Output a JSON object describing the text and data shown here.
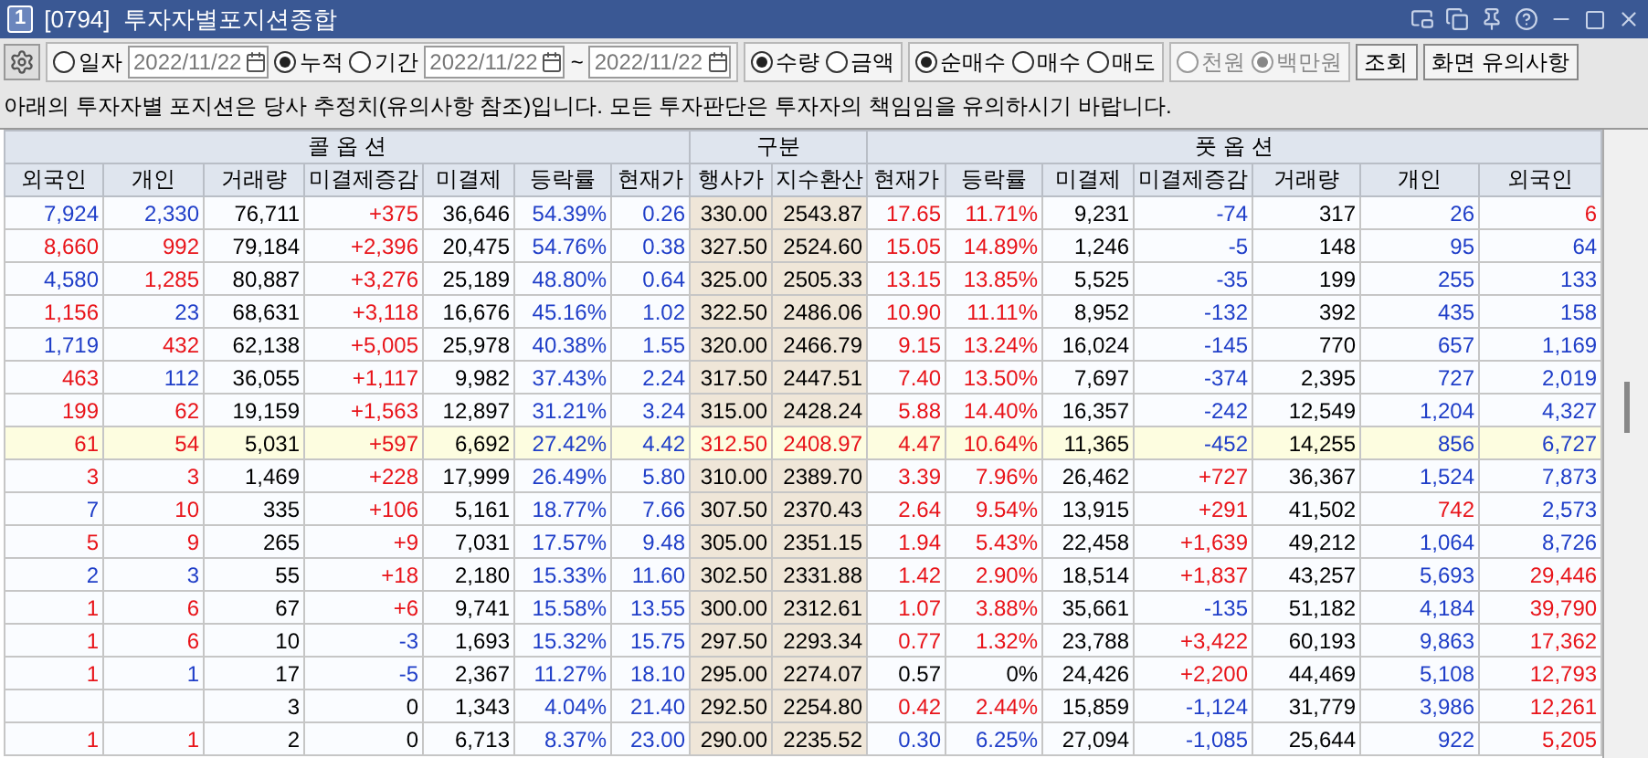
{
  "window": {
    "badge": "1",
    "title": "[0794]  투자자별포지션종합"
  },
  "toolbar": [
    {
      "kind": "radio",
      "label": "일자",
      "selected": false
    },
    {
      "kind": "date",
      "value": "2022/11/22"
    },
    {
      "kind": "radio",
      "label": "누적",
      "selected": true
    },
    {
      "kind": "radio",
      "label": "기간",
      "selected": false
    },
    {
      "kind": "date",
      "value": "2022/11/22"
    },
    {
      "kind": "text",
      "text": "~"
    },
    {
      "kind": "date",
      "value": "2022/11/22"
    }
  ],
  "radio_groups": [
    {
      "disabled": false,
      "options": [
        {
          "label": "수량",
          "selected": true
        },
        {
          "label": "금액",
          "selected": false
        }
      ]
    },
    {
      "disabled": false,
      "options": [
        {
          "label": "순매수",
          "selected": true
        },
        {
          "label": "매수",
          "selected": false
        },
        {
          "label": "매도",
          "selected": false
        }
      ]
    },
    {
      "disabled": true,
      "options": [
        {
          "label": "천원",
          "selected": false
        },
        {
          "label": "백만원",
          "selected": true
        }
      ]
    }
  ],
  "buttons": [
    "조회",
    "화면 유의사항"
  ],
  "notice": "아래의 투자자별 포지션은 당사 추정치(유의사항 참조)입니다. 모든 투자판단은 투자자의 책임임을 유의하시기 바랍니다.",
  "table": {
    "groups": [
      {
        "label": "콜 옵 션",
        "kind": "option"
      },
      {
        "label": "구분",
        "kind": "strike"
      },
      {
        "label": "풋 옵 션",
        "kind": "option"
      }
    ],
    "columns": [
      "외국인",
      "개인",
      "거래량",
      "미결제증감",
      "미결제",
      "등락률",
      "현재가",
      "행사가",
      "지수환산",
      "현재가",
      "등락률",
      "미결제",
      "미결제증감",
      "거래량",
      "개인",
      "외국인"
    ],
    "rows": [
      {
        "highlighted": false,
        "cells": [
          {
            "text": "7,924",
            "color": "#1f3ec8"
          },
          {
            "text": "2,330",
            "color": "#1f3ec8"
          },
          {
            "text": "76,711"
          },
          {
            "text": "+375",
            "color": "#e8141a"
          },
          {
            "text": "36,646"
          },
          {
            "text": "54.39%",
            "color": "#1f3ec8"
          },
          {
            "text": "0.26",
            "color": "#1f3ec8"
          },
          {
            "text": "330.00"
          },
          {
            "text": "2543.87"
          },
          {
            "text": "17.65",
            "color": "#e8141a"
          },
          {
            "text": "11.71%",
            "color": "#e8141a"
          },
          {
            "text": "9,231"
          },
          {
            "text": "-74",
            "color": "#1f3ec8"
          },
          {
            "text": "317"
          },
          {
            "text": "26",
            "color": "#1f3ec8"
          },
          {
            "text": "6",
            "color": "#e8141a"
          }
        ]
      },
      {
        "highlighted": false,
        "cells": [
          {
            "text": "8,660",
            "color": "#e8141a"
          },
          {
            "text": "992",
            "color": "#e8141a"
          },
          {
            "text": "79,184"
          },
          {
            "text": "+2,396",
            "color": "#e8141a"
          },
          {
            "text": "20,475"
          },
          {
            "text": "54.76%",
            "color": "#1f3ec8"
          },
          {
            "text": "0.38",
            "color": "#1f3ec8"
          },
          {
            "text": "327.50"
          },
          {
            "text": "2524.60"
          },
          {
            "text": "15.05",
            "color": "#e8141a"
          },
          {
            "text": "14.89%",
            "color": "#e8141a"
          },
          {
            "text": "1,246"
          },
          {
            "text": "-5",
            "color": "#1f3ec8"
          },
          {
            "text": "148"
          },
          {
            "text": "95",
            "color": "#1f3ec8"
          },
          {
            "text": "64",
            "color": "#1f3ec8"
          }
        ]
      },
      {
        "highlighted": false,
        "cells": [
          {
            "text": "4,580",
            "color": "#1f3ec8"
          },
          {
            "text": "1,285",
            "color": "#e8141a"
          },
          {
            "text": "80,887"
          },
          {
            "text": "+3,276",
            "color": "#e8141a"
          },
          {
            "text": "25,189"
          },
          {
            "text": "48.80%",
            "color": "#1f3ec8"
          },
          {
            "text": "0.64",
            "color": "#1f3ec8"
          },
          {
            "text": "325.00"
          },
          {
            "text": "2505.33"
          },
          {
            "text": "13.15",
            "color": "#e8141a"
          },
          {
            "text": "13.85%",
            "color": "#e8141a"
          },
          {
            "text": "5,525"
          },
          {
            "text": "-35",
            "color": "#1f3ec8"
          },
          {
            "text": "199"
          },
          {
            "text": "255",
            "color": "#1f3ec8"
          },
          {
            "text": "133",
            "color": "#1f3ec8"
          }
        ]
      },
      {
        "highlighted": false,
        "cells": [
          {
            "text": "1,156",
            "color": "#e8141a"
          },
          {
            "text": "23",
            "color": "#1f3ec8"
          },
          {
            "text": "68,631"
          },
          {
            "text": "+3,118",
            "color": "#e8141a"
          },
          {
            "text": "16,676"
          },
          {
            "text": "45.16%",
            "color": "#1f3ec8"
          },
          {
            "text": "1.02",
            "color": "#1f3ec8"
          },
          {
            "text": "322.50"
          },
          {
            "text": "2486.06"
          },
          {
            "text": "10.90",
            "color": "#e8141a"
          },
          {
            "text": "11.11%",
            "color": "#e8141a"
          },
          {
            "text": "8,952"
          },
          {
            "text": "-132",
            "color": "#1f3ec8"
          },
          {
            "text": "392"
          },
          {
            "text": "435",
            "color": "#1f3ec8"
          },
          {
            "text": "158",
            "color": "#1f3ec8"
          }
        ]
      },
      {
        "highlighted": false,
        "cells": [
          {
            "text": "1,719",
            "color": "#1f3ec8"
          },
          {
            "text": "432",
            "color": "#e8141a"
          },
          {
            "text": "62,138"
          },
          {
            "text": "+5,005",
            "color": "#e8141a"
          },
          {
            "text": "25,978"
          },
          {
            "text": "40.38%",
            "color": "#1f3ec8"
          },
          {
            "text": "1.55",
            "color": "#1f3ec8"
          },
          {
            "text": "320.00"
          },
          {
            "text": "2466.79"
          },
          {
            "text": "9.15",
            "color": "#e8141a"
          },
          {
            "text": "13.24%",
            "color": "#e8141a"
          },
          {
            "text": "16,024"
          },
          {
            "text": "-145",
            "color": "#1f3ec8"
          },
          {
            "text": "770"
          },
          {
            "text": "657",
            "color": "#1f3ec8"
          },
          {
            "text": "1,169",
            "color": "#1f3ec8"
          }
        ]
      },
      {
        "highlighted": false,
        "cells": [
          {
            "text": "463",
            "color": "#e8141a"
          },
          {
            "text": "112",
            "color": "#1f3ec8"
          },
          {
            "text": "36,055"
          },
          {
            "text": "+1,117",
            "color": "#e8141a"
          },
          {
            "text": "9,982"
          },
          {
            "text": "37.43%",
            "color": "#1f3ec8"
          },
          {
            "text": "2.24",
            "color": "#1f3ec8"
          },
          {
            "text": "317.50"
          },
          {
            "text": "2447.51"
          },
          {
            "text": "7.40",
            "color": "#e8141a"
          },
          {
            "text": "13.50%",
            "color": "#e8141a"
          },
          {
            "text": "7,697"
          },
          {
            "text": "-374",
            "color": "#1f3ec8"
          },
          {
            "text": "2,395"
          },
          {
            "text": "727",
            "color": "#1f3ec8"
          },
          {
            "text": "2,019",
            "color": "#1f3ec8"
          }
        ]
      },
      {
        "highlighted": false,
        "cells": [
          {
            "text": "199",
            "color": "#e8141a"
          },
          {
            "text": "62",
            "color": "#e8141a"
          },
          {
            "text": "19,159"
          },
          {
            "text": "+1,563",
            "color": "#e8141a"
          },
          {
            "text": "12,897"
          },
          {
            "text": "31.21%",
            "color": "#1f3ec8"
          },
          {
            "text": "3.24",
            "color": "#1f3ec8"
          },
          {
            "text": "315.00"
          },
          {
            "text": "2428.24"
          },
          {
            "text": "5.88",
            "color": "#e8141a"
          },
          {
            "text": "14.40%",
            "color": "#e8141a"
          },
          {
            "text": "16,357"
          },
          {
            "text": "-242",
            "color": "#1f3ec8"
          },
          {
            "text": "12,549"
          },
          {
            "text": "1,204",
            "color": "#1f3ec8"
          },
          {
            "text": "4,327",
            "color": "#1f3ec8"
          }
        ]
      },
      {
        "highlighted": true,
        "cells": [
          {
            "text": "61",
            "color": "#e8141a"
          },
          {
            "text": "54",
            "color": "#e8141a"
          },
          {
            "text": "5,031"
          },
          {
            "text": "+597",
            "color": "#e8141a"
          },
          {
            "text": "6,692"
          },
          {
            "text": "27.42%",
            "color": "#1f3ec8"
          },
          {
            "text": "4.42",
            "color": "#1f3ec8"
          },
          {
            "text": "312.50",
            "color": "#e8141a"
          },
          {
            "text": "2408.97",
            "color": "#e8141a"
          },
          {
            "text": "4.47",
            "color": "#e8141a"
          },
          {
            "text": "10.64%",
            "color": "#e8141a"
          },
          {
            "text": "11,365"
          },
          {
            "text": "-452",
            "color": "#1f3ec8"
          },
          {
            "text": "14,255"
          },
          {
            "text": "856",
            "color": "#1f3ec8"
          },
          {
            "text": "6,727",
            "color": "#1f3ec8"
          }
        ]
      },
      {
        "highlighted": false,
        "cells": [
          {
            "text": "3",
            "color": "#e8141a"
          },
          {
            "text": "3",
            "color": "#e8141a"
          },
          {
            "text": "1,469"
          },
          {
            "text": "+228",
            "color": "#e8141a"
          },
          {
            "text": "17,999"
          },
          {
            "text": "26.49%",
            "color": "#1f3ec8"
          },
          {
            "text": "5.80",
            "color": "#1f3ec8"
          },
          {
            "text": "310.00"
          },
          {
            "text": "2389.70"
          },
          {
            "text": "3.39",
            "color": "#e8141a"
          },
          {
            "text": "7.96%",
            "color": "#e8141a"
          },
          {
            "text": "26,462"
          },
          {
            "text": "+727",
            "color": "#e8141a"
          },
          {
            "text": "36,367"
          },
          {
            "text": "1,524",
            "color": "#1f3ec8"
          },
          {
            "text": "7,873",
            "color": "#1f3ec8"
          }
        ]
      },
      {
        "highlighted": false,
        "cells": [
          {
            "text": "7",
            "color": "#1f3ec8"
          },
          {
            "text": "10",
            "color": "#e8141a"
          },
          {
            "text": "335"
          },
          {
            "text": "+106",
            "color": "#e8141a"
          },
          {
            "text": "5,161"
          },
          {
            "text": "18.77%",
            "color": "#1f3ec8"
          },
          {
            "text": "7.66",
            "color": "#1f3ec8"
          },
          {
            "text": "307.50"
          },
          {
            "text": "2370.43"
          },
          {
            "text": "2.64",
            "color": "#e8141a"
          },
          {
            "text": "9.54%",
            "color": "#e8141a"
          },
          {
            "text": "13,915"
          },
          {
            "text": "+291",
            "color": "#e8141a"
          },
          {
            "text": "41,502"
          },
          {
            "text": "742",
            "color": "#e8141a"
          },
          {
            "text": "2,573",
            "color": "#1f3ec8"
          }
        ]
      },
      {
        "highlighted": false,
        "cells": [
          {
            "text": "5",
            "color": "#e8141a"
          },
          {
            "text": "9",
            "color": "#e8141a"
          },
          {
            "text": "265"
          },
          {
            "text": "+9",
            "color": "#e8141a"
          },
          {
            "text": "7,031"
          },
          {
            "text": "17.57%",
            "color": "#1f3ec8"
          },
          {
            "text": "9.48",
            "color": "#1f3ec8"
          },
          {
            "text": "305.00"
          },
          {
            "text": "2351.15"
          },
          {
            "text": "1.94",
            "color": "#e8141a"
          },
          {
            "text": "5.43%",
            "color": "#e8141a"
          },
          {
            "text": "22,458"
          },
          {
            "text": "+1,639",
            "color": "#e8141a"
          },
          {
            "text": "49,212"
          },
          {
            "text": "1,064",
            "color": "#1f3ec8"
          },
          {
            "text": "8,726",
            "color": "#1f3ec8"
          }
        ]
      },
      {
        "highlighted": false,
        "cells": [
          {
            "text": "2",
            "color": "#1f3ec8"
          },
          {
            "text": "3",
            "color": "#1f3ec8"
          },
          {
            "text": "55"
          },
          {
            "text": "+18",
            "color": "#e8141a"
          },
          {
            "text": "2,180"
          },
          {
            "text": "15.33%",
            "color": "#1f3ec8"
          },
          {
            "text": "11.60",
            "color": "#1f3ec8"
          },
          {
            "text": "302.50"
          },
          {
            "text": "2331.88"
          },
          {
            "text": "1.42",
            "color": "#e8141a"
          },
          {
            "text": "2.90%",
            "color": "#e8141a"
          },
          {
            "text": "18,514"
          },
          {
            "text": "+1,837",
            "color": "#e8141a"
          },
          {
            "text": "43,257"
          },
          {
            "text": "5,693",
            "color": "#1f3ec8"
          },
          {
            "text": "29,446",
            "color": "#e8141a"
          }
        ]
      },
      {
        "highlighted": false,
        "cells": [
          {
            "text": "1",
            "color": "#e8141a"
          },
          {
            "text": "6",
            "color": "#e8141a"
          },
          {
            "text": "67"
          },
          {
            "text": "+6",
            "color": "#e8141a"
          },
          {
            "text": "9,741"
          },
          {
            "text": "15.58%",
            "color": "#1f3ec8"
          },
          {
            "text": "13.55",
            "color": "#1f3ec8"
          },
          {
            "text": "300.00"
          },
          {
            "text": "2312.61"
          },
          {
            "text": "1.07",
            "color": "#e8141a"
          },
          {
            "text": "3.88%",
            "color": "#e8141a"
          },
          {
            "text": "35,661"
          },
          {
            "text": "-135",
            "color": "#1f3ec8"
          },
          {
            "text": "51,182"
          },
          {
            "text": "4,184",
            "color": "#1f3ec8"
          },
          {
            "text": "39,790",
            "color": "#e8141a"
          }
        ]
      },
      {
        "highlighted": false,
        "cells": [
          {
            "text": "1",
            "color": "#e8141a"
          },
          {
            "text": "6",
            "color": "#e8141a"
          },
          {
            "text": "10"
          },
          {
            "text": "-3",
            "color": "#1f3ec8"
          },
          {
            "text": "1,693"
          },
          {
            "text": "15.32%",
            "color": "#1f3ec8"
          },
          {
            "text": "15.75",
            "color": "#1f3ec8"
          },
          {
            "text": "297.50"
          },
          {
            "text": "2293.34"
          },
          {
            "text": "0.77",
            "color": "#e8141a"
          },
          {
            "text": "1.32%",
            "color": "#e8141a"
          },
          {
            "text": "23,788"
          },
          {
            "text": "+3,422",
            "color": "#e8141a"
          },
          {
            "text": "60,193"
          },
          {
            "text": "9,863",
            "color": "#1f3ec8"
          },
          {
            "text": "17,362",
            "color": "#e8141a"
          }
        ]
      },
      {
        "highlighted": false,
        "cells": [
          {
            "text": "1",
            "color": "#e8141a"
          },
          {
            "text": "1",
            "color": "#1f3ec8"
          },
          {
            "text": "17"
          },
          {
            "text": "-5",
            "color": "#1f3ec8"
          },
          {
            "text": "2,367"
          },
          {
            "text": "11.27%",
            "color": "#1f3ec8"
          },
          {
            "text": "18.10",
            "color": "#1f3ec8"
          },
          {
            "text": "295.00"
          },
          {
            "text": "2274.07"
          },
          {
            "text": "0.57"
          },
          {
            "text": "0%"
          },
          {
            "text": "24,426"
          },
          {
            "text": "+2,200",
            "color": "#e8141a"
          },
          {
            "text": "44,469"
          },
          {
            "text": "5,108",
            "color": "#1f3ec8"
          },
          {
            "text": "12,793",
            "color": "#e8141a"
          }
        ]
      },
      {
        "highlighted": false,
        "cells": [
          null,
          null,
          {
            "text": "3"
          },
          {
            "text": "0"
          },
          {
            "text": "1,343"
          },
          {
            "text": "4.04%",
            "color": "#1f3ec8"
          },
          {
            "text": "21.40",
            "color": "#1f3ec8"
          },
          {
            "text": "292.50"
          },
          {
            "text": "2254.80"
          },
          {
            "text": "0.42",
            "color": "#e8141a"
          },
          {
            "text": "2.44%",
            "color": "#e8141a"
          },
          {
            "text": "15,859"
          },
          {
            "text": "-1,124",
            "color": "#1f3ec8"
          },
          {
            "text": "31,779"
          },
          {
            "text": "3,986",
            "color": "#1f3ec8"
          },
          {
            "text": "12,261",
            "color": "#e8141a"
          }
        ]
      },
      {
        "highlighted": false,
        "cells": [
          {
            "text": "1",
            "color": "#e8141a"
          },
          {
            "text": "1",
            "color": "#e8141a"
          },
          {
            "text": "2"
          },
          {
            "text": "0"
          },
          {
            "text": "6,713"
          },
          {
            "text": "8.37%",
            "color": "#1f3ec8"
          },
          {
            "text": "23.00",
            "color": "#1f3ec8"
          },
          {
            "text": "290.00"
          },
          {
            "text": "2235.52"
          },
          {
            "text": "0.30",
            "color": "#1f3ec8"
          },
          {
            "text": "6.25%",
            "color": "#1f3ec8"
          },
          {
            "text": "27,094"
          },
          {
            "text": "-1,085",
            "color": "#1f3ec8"
          },
          {
            "text": "25,644"
          },
          {
            "text": "922",
            "color": "#1f3ec8"
          },
          {
            "text": "5,205",
            "color": "#e8141a"
          }
        ]
      }
    ]
  }
}
